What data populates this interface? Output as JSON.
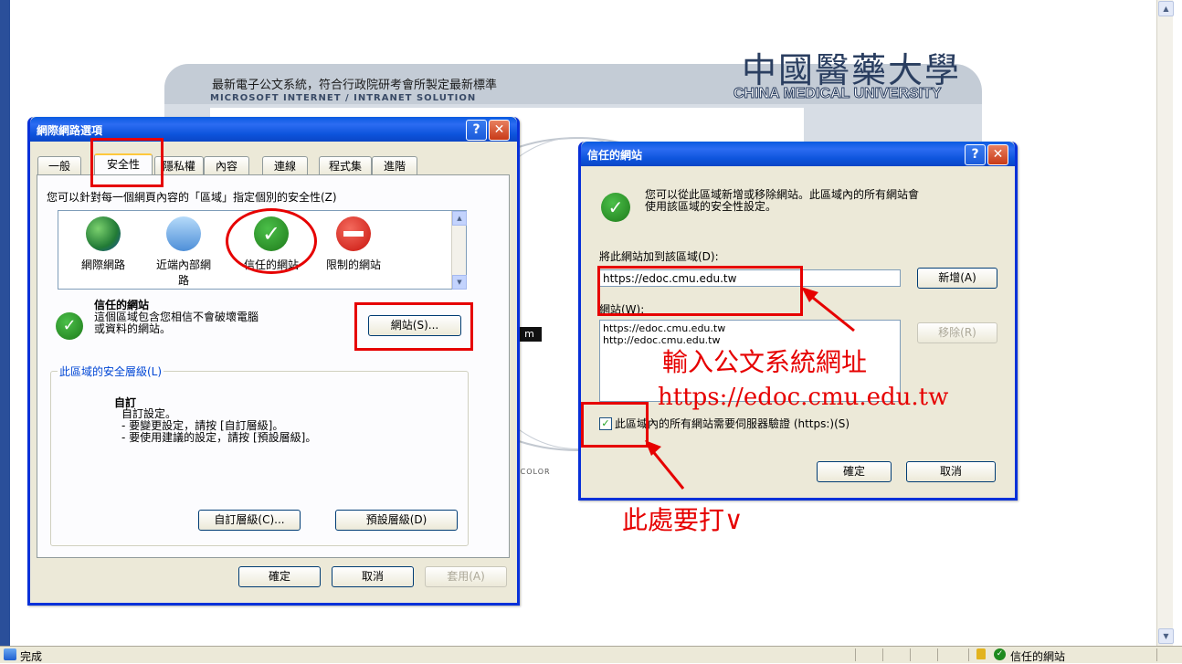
{
  "banner": {
    "subtitle_cn": "最新電子公文系統，符合行政院研考會所製定最新標準",
    "subtitle_en": "MICROSOFT INTERNET / INTRANET SOLUTION",
    "university_cn": "中國醫藥大學",
    "university_en": "CHINA MEDICAL UNIVERSITY",
    "chip_text": "m",
    "footer_text": "SH COLOR"
  },
  "internet_options": {
    "title": "網際網路選項",
    "tabs": [
      "一般",
      "安全性",
      "隱私權",
      "內容",
      "連線",
      "程式集",
      "進階"
    ],
    "selected_tab": "安全性",
    "instruction": "您可以針對每一個網頁內容的「區域」指定個別的安全性(Z)",
    "zones": [
      {
        "label": "網際網路",
        "icon": "globe-icon"
      },
      {
        "label": "近端內部網路",
        "icon": "monitor-icon"
      },
      {
        "label": "信任的網站",
        "icon": "check-icon"
      },
      {
        "label": "限制的網站",
        "icon": "no-entry-icon"
      }
    ],
    "zone_name": "信任的網站",
    "zone_desc_1": "這個區域包含您相信不會破壞電腦",
    "zone_desc_2": "或資料的網站。",
    "sites_button": "網站(S)...",
    "security_level_legend": "此區域的安全層級(L)",
    "custom_title": "自訂",
    "custom_lines": [
      "自訂設定。",
      "- 要變更設定，請按 [自訂層級]。",
      "- 要使用建議的設定，請按 [預設層級]。"
    ],
    "custom_level_button": "自訂層級(C)...",
    "default_level_button": "預設層級(D)",
    "ok": "確定",
    "cancel": "取消",
    "apply": "套用(A)"
  },
  "trusted_sites": {
    "title": "信任的網站",
    "desc_1": "您可以從此區域新增或移除網站。此區域內的所有網站會",
    "desc_2": "使用該區域的安全性設定。",
    "add_label": "將此網站加到該區域(D):",
    "url_value": "https://edoc.cmu.edu.tw",
    "add_button": "新增(A)",
    "sites_label": "網站(W):",
    "sites": [
      "https://edoc.cmu.edu.tw",
      "http://edoc.cmu.edu.tw"
    ],
    "remove_button": "移除(R)",
    "https_checkbox_label": "此區域內的所有網站需要伺服器驗證 (https:)(S)",
    "https_checked": true,
    "ok": "確定",
    "cancel": "取消"
  },
  "annotations": {
    "url_note_1": "輸入公文系統網址",
    "url_note_2": "https://edoc.cmu.edu.tw",
    "check_note": "此處要打∨"
  },
  "statusbar": {
    "status_text": "完成",
    "zone_text": "信任的網站"
  },
  "colors": {
    "annotation_red": "#e60000",
    "xp_blue": "#0a5be0",
    "window_bg": "#ece9d8"
  }
}
